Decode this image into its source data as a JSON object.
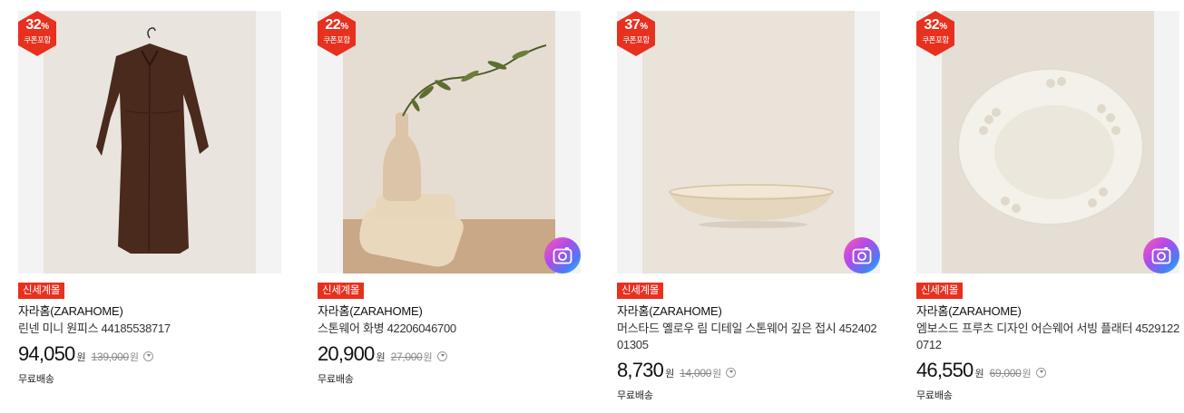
{
  "products": [
    {
      "discount": "32",
      "discount_unit": "%",
      "coupon_label": "쿠폰포함",
      "tag": "신세계몰",
      "brand": "자라홈(ZARAHOME)",
      "title": "린넨 미니 원피스 44185538717",
      "price": "94,050",
      "currency": "원",
      "original_price": "139,000",
      "original_currency": "원",
      "shipping": "무료배송",
      "image_subject": "brown-linen-dress",
      "has_camera": false
    },
    {
      "discount": "22",
      "discount_unit": "%",
      "coupon_label": "쿠폰포함",
      "tag": "신세계몰",
      "brand": "자라홈(ZARAHOME)",
      "title": "스톤웨어 화병 42206046700",
      "price": "20,900",
      "currency": "원",
      "original_price": "27,000",
      "original_currency": "원",
      "shipping": "무료배송",
      "image_subject": "stoneware-vase",
      "has_camera": true
    },
    {
      "discount": "37",
      "discount_unit": "%",
      "coupon_label": "쿠폰포함",
      "tag": "신세계몰",
      "brand": "자라홈(ZARAHOME)",
      "title": "머스타드 옐로우 림 디테일 스톤웨어 깊은 접시 452402 01305",
      "price": "8,730",
      "currency": "원",
      "original_price": "14,000",
      "original_currency": "원",
      "shipping": "무료배송",
      "image_subject": "stoneware-bowl",
      "has_camera": true
    },
    {
      "discount": "32",
      "discount_unit": "%",
      "coupon_label": "쿠폰포함",
      "tag": "신세계몰",
      "brand": "자라홈(ZARAHOME)",
      "title": "엠보스드 프루츠 디자인 어슨웨어 서빙 플래터 4529122 0712",
      "price": "46,550",
      "currency": "원",
      "original_price": "69,000",
      "original_currency": "원",
      "shipping": "무료배송",
      "image_subject": "embossed-platter",
      "has_camera": true
    }
  ],
  "colors": {
    "badge_red": "#e8301f",
    "tag_red": "#e8301f",
    "price_text": "#111111",
    "strike_text": "#888888"
  }
}
